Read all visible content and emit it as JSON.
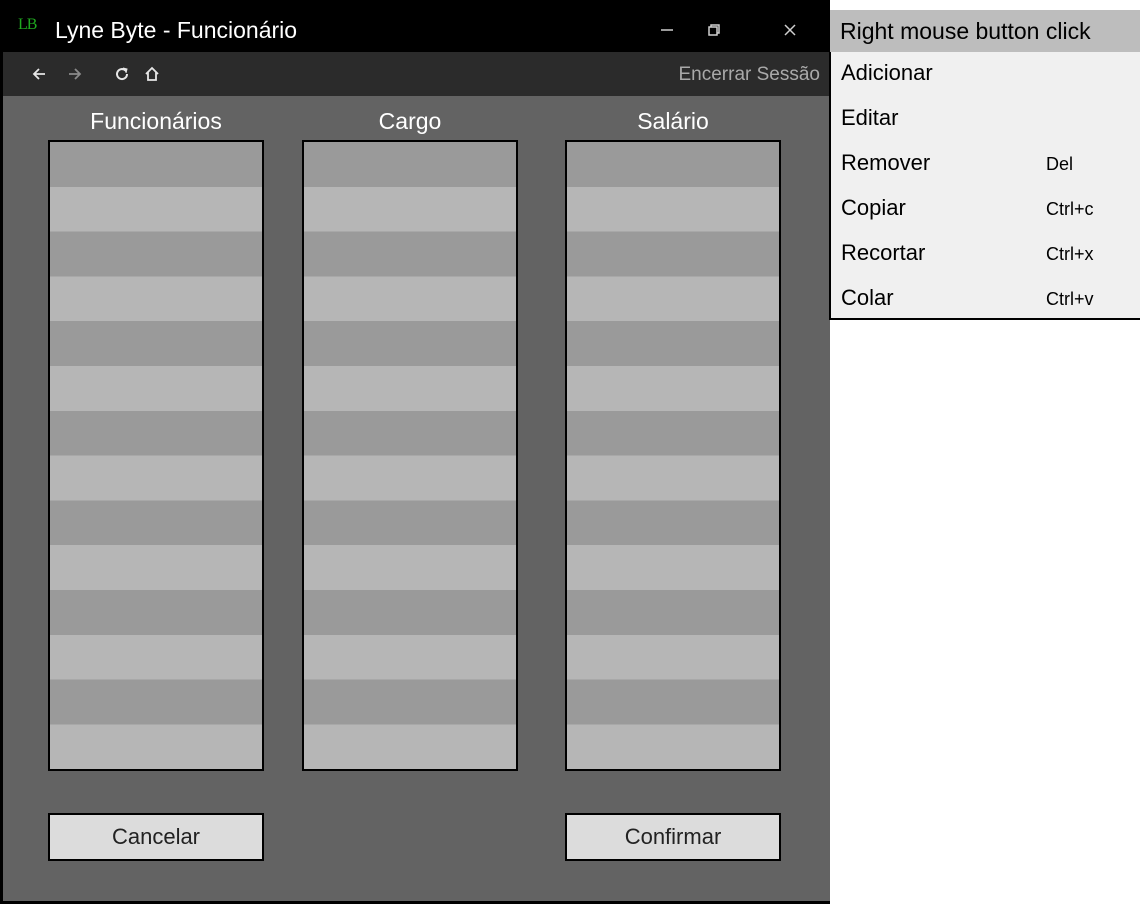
{
  "window": {
    "logo": "LB",
    "title": "Lyne Byte - Funcionário",
    "controls": {
      "minimize_icon": "minimize-icon",
      "restore_icon": "restore-icon",
      "close_icon": "close-icon"
    }
  },
  "navbar": {
    "icons": [
      "back-arrow-icon",
      "forward-arrow-icon",
      "refresh-icon",
      "home-icon"
    ],
    "logout_label": "Encerrar Sessão"
  },
  "columns": [
    {
      "header": "Funcionários"
    },
    {
      "header": "Cargo"
    },
    {
      "header": "Salário"
    }
  ],
  "buttons": {
    "cancel_label": "Cancelar",
    "confirm_label": "Confirmar"
  },
  "context_menu": {
    "header": "Right mouse button click",
    "items": [
      {
        "label": "Adicionar",
        "shortcut": ""
      },
      {
        "label": "Editar",
        "shortcut": ""
      },
      {
        "label": "Remover",
        "shortcut": "Del"
      },
      {
        "label": "Copiar",
        "shortcut": "Ctrl+c"
      },
      {
        "label": "Recortar",
        "shortcut": "Ctrl+x"
      },
      {
        "label": "Colar",
        "shortcut": "Ctrl+v"
      }
    ]
  },
  "colors": {
    "window_bg": "#636363",
    "titlebar_bg": "#000000",
    "navbar_bg": "#2b2b2b",
    "logo": "#1fa81f",
    "stripe_dark": "#9a9a9a",
    "stripe_light": "#b6b6b6",
    "button_bg": "#dcdcdc",
    "menu_bg": "#f0f0f0",
    "menu_header_bg": "#bdbdbd"
  }
}
